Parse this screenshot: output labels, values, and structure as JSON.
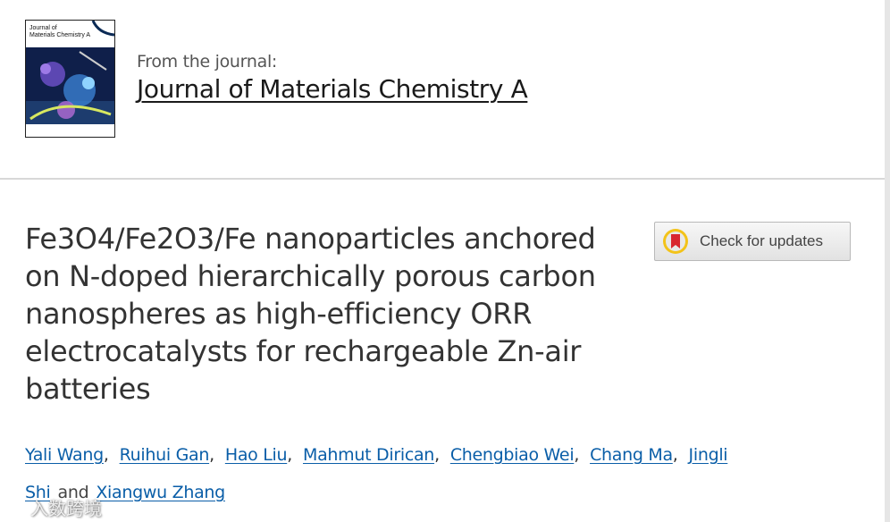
{
  "header": {
    "cover": {
      "title_line1": "Journal of",
      "title_line2": "Materials Chemistry A"
    },
    "from_label": "From the journal:",
    "journal_name": "Journal of Materials Chemistry A"
  },
  "article": {
    "title": "Fe3O4/Fe2O3/Fe nanoparticles anchored on N-doped hierarchically porous carbon nanospheres as high-efficiency ORR electrocatalysts for rechargeable Zn-air batteries",
    "check_updates_label": "Check for updates",
    "authors": [
      "Yali Wang",
      "Ruihui Gan",
      "Hao Liu",
      "Mahmut Dirican",
      "Chengbiao Wei",
      "Chang Ma",
      "Jingli Shi",
      "Xiangwu Zhang"
    ],
    "authors_conjunction": "and"
  },
  "watermark": {
    "text": "入数跨境"
  },
  "colors": {
    "link": "#0a5ea8",
    "title": "#333333",
    "divider": "#d8d8d8"
  }
}
